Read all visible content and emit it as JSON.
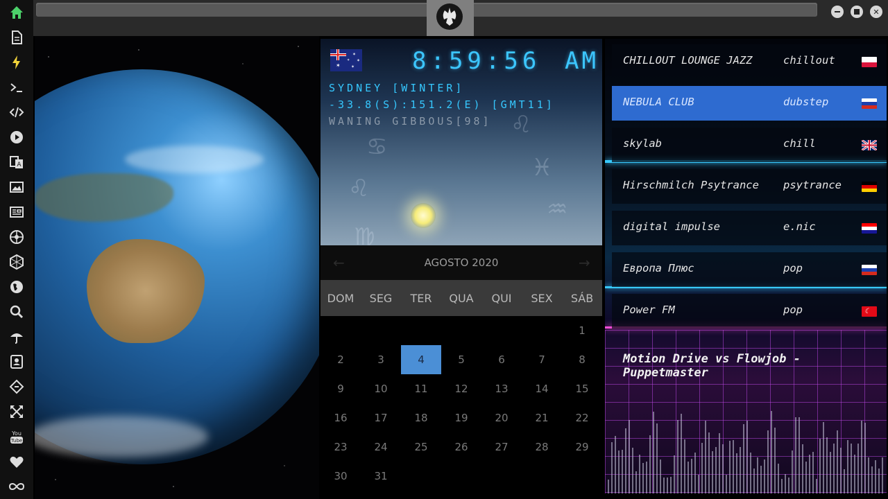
{
  "sidebar": {
    "icons": [
      "home-icon",
      "document-icon",
      "lightning-icon",
      "terminal-icon",
      "code-icon",
      "play-icon",
      "translate-icon",
      "image-icon",
      "news-icon",
      "rebel-icon",
      "hexagon-icon",
      "globe-icon",
      "search-icon",
      "umbrella-icon",
      "contacts-icon",
      "tag-icon",
      "expand-icon",
      "youtube-icon",
      "heart-icon",
      "infinity-icon"
    ],
    "youtube_label": "You Tube",
    "accent": "#4cd16a"
  },
  "clock": {
    "time": "8:59:56",
    "ampm": "AM",
    "city_line": "SYDNEY [WINTER]",
    "coords_line": "-33.8(S):151.2(E) [GMT11]",
    "moon_line": "WANING GIBBOUS[98]",
    "color": "#3cc6ff"
  },
  "calendar": {
    "title": "AGOSTO 2020",
    "prev": "←",
    "next": "→",
    "weekdays": [
      "DOM",
      "SEG",
      "TER",
      "QUA",
      "QUI",
      "SEX",
      "SÁB"
    ],
    "days": [
      "",
      "",
      "",
      "",
      "",
      "",
      "1",
      "2",
      "3",
      "4",
      "5",
      "6",
      "7",
      "8",
      "9",
      "10",
      "11",
      "12",
      "13",
      "14",
      "15",
      "16",
      "17",
      "18",
      "19",
      "20",
      "21",
      "22",
      "23",
      "24",
      "25",
      "26",
      "27",
      "28",
      "29",
      "30",
      "31"
    ],
    "today": "4",
    "today_color": "#4b8fd6"
  },
  "radio": {
    "stations": [
      {
        "name": "CHILLOUT LOUNGE JAZZ",
        "genre": "chillout",
        "flag": "pl"
      },
      {
        "name": "NEBULA CLUB",
        "genre": "dubstep",
        "flag": "ru"
      },
      {
        "name": "skylab",
        "genre": "chill",
        "flag": "gb"
      },
      {
        "name": "Hirschmilch Psytrance",
        "genre": "psytrance",
        "flag": "de"
      },
      {
        "name": "digital impulse",
        "genre": "e.nic",
        "flag": "hr"
      },
      {
        "name": "Европа Плюс",
        "genre": "pop",
        "flag": "ru"
      },
      {
        "name": "Power FM",
        "genre": "pop",
        "flag": "tr"
      }
    ],
    "active_index": 1,
    "now_playing": "Motion Drive vs Flowjob - Puppetmaster"
  }
}
